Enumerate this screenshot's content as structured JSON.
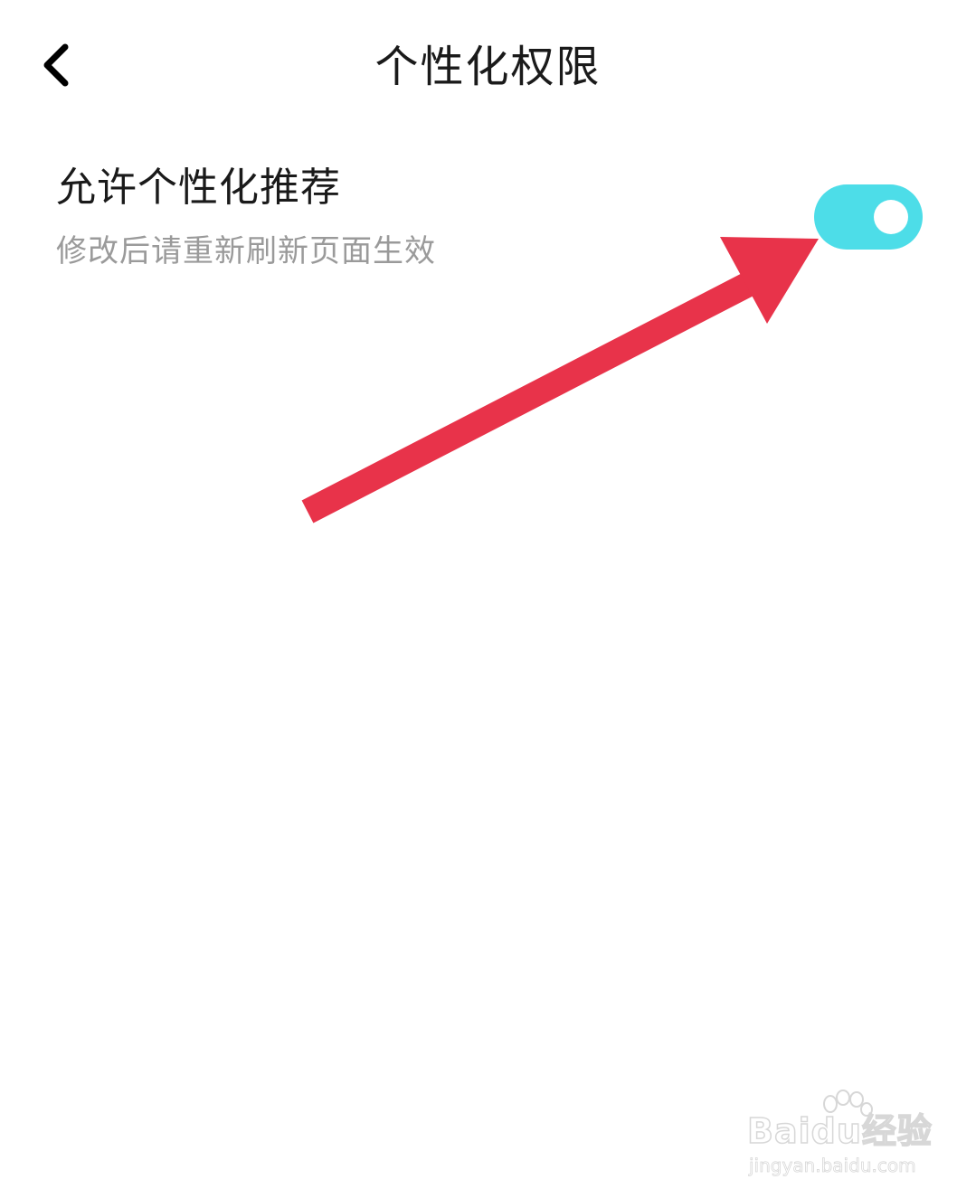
{
  "header": {
    "back_icon": "chevron-left-icon",
    "title": "个性化权限"
  },
  "setting": {
    "title": "允许个性化推荐",
    "description": "修改后请重新刷新页面生效",
    "toggle_on": true,
    "toggle_color": "#4DDDE8"
  },
  "annotation": {
    "arrow_color": "#E8334A",
    "arrow_icon": "arrow-pointer-icon"
  },
  "watermark": {
    "brand": "Baidu经验",
    "url": "jingyan.baidu.com",
    "logo_icon": "paw-icon"
  }
}
